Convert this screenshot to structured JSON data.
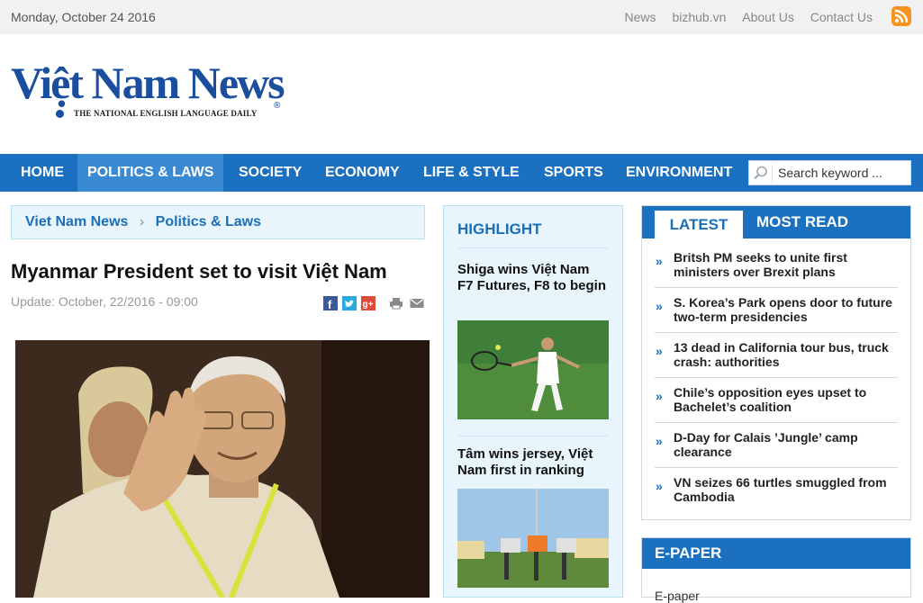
{
  "topbar": {
    "date": "Monday, October 24 2016",
    "links": [
      "News",
      "bizhub.vn",
      "About Us",
      "Contact Us"
    ],
    "rss_icon": "rss-icon"
  },
  "logo": {
    "name": "Việt Nam News",
    "tagline": "THE NATIONAL ENGLISH LANGUAGE DAILY",
    "reg": "®"
  },
  "nav": {
    "items": [
      "HOME",
      "POLITICS & LAWS",
      "SOCIETY",
      "ECONOMY",
      "LIFE & STYLE",
      "SPORTS",
      "ENVIRONMENT"
    ],
    "active": "POLITICS & LAWS",
    "search_placeholder": "Search keyword ..."
  },
  "breadcrumb": {
    "root": "Viet Nam News",
    "separator": "›",
    "current": "Politics & Laws"
  },
  "article": {
    "title": "Myanmar President set to visit Việt Nam",
    "update": "Update: October, 22/2016 - 09:00",
    "share_icons": [
      "facebook-icon",
      "twitter-icon",
      "google-plus-icon",
      "print-icon",
      "email-icon"
    ]
  },
  "highlight": {
    "title": "HIGHLIGHT",
    "stories": [
      "Shiga wins Việt Nam F7 Futures, F8 to begin",
      "Tâm wins jersey, Việt Nam first in ranking"
    ]
  },
  "sidebar": {
    "tab_latest": "LATEST",
    "tab_most_read": "MOST READ",
    "news": [
      "Britsh PM seeks to unite first ministers over Brexit plans",
      "S. Korea’s Park opens door to future two-term presidencies",
      "13 dead in California tour bus, truck crash: authorities",
      "Chile’s opposition eyes upset to Bachelet’s coalition",
      "D-Day for Calais ’Jungle’ camp clearance",
      "VN seizes 66 turtles smuggled from Cambodia"
    ],
    "arrow": "»"
  },
  "epaper": {
    "title": "E-PAPER",
    "link": "E-paper"
  },
  "colors": {
    "brand_blue": "#1b70c0",
    "light_blue_bg": "#e9f5fc",
    "rss_orange": "#f7931e"
  }
}
